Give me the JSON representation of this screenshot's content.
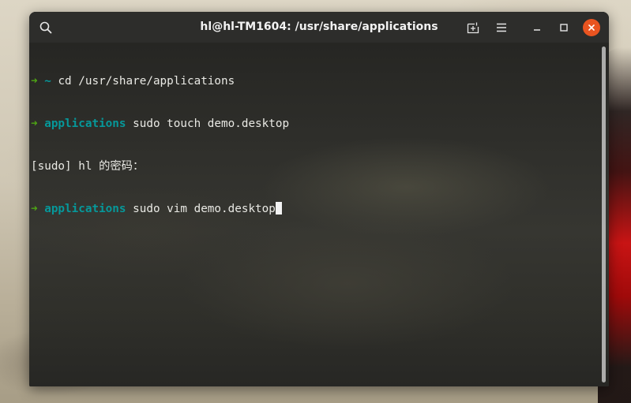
{
  "window": {
    "title": "hl@hl-TM1604: /usr/share/applications"
  },
  "titlebar": {
    "icons": [
      "search-icon",
      "new-tab-icon",
      "hamburger-menu-icon",
      "minimize-icon",
      "maximize-icon",
      "close-icon"
    ]
  },
  "colors": {
    "prompt_arrow": "#4ea614",
    "directory": "#06989a",
    "close_button": "#e95420",
    "text": "#e9e9e4"
  },
  "terminal": {
    "lines": [
      {
        "arrow": "➜",
        "dir": "~",
        "cmd": "cd /usr/share/applications"
      },
      {
        "arrow": "➜",
        "dir": "applications",
        "cmd": "sudo touch demo.desktop"
      },
      {
        "text": "[sudo] hl 的密码："
      },
      {
        "arrow": "➜",
        "dir": "applications",
        "cmd": "sudo vim demo.desktop"
      }
    ]
  }
}
